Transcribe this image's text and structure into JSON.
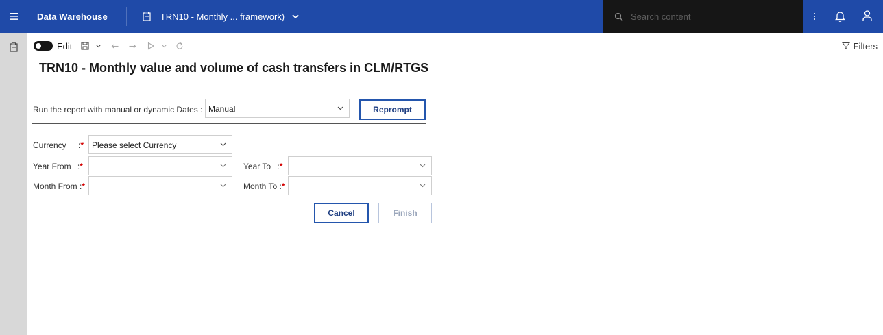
{
  "topbar": {
    "app_title": "Data Warehouse",
    "report_tab": "TRN10 - Monthly ... framework)",
    "search_placeholder": "Search content"
  },
  "toolbar": {
    "edit_label": "Edit",
    "filters_label": "Filters"
  },
  "page": {
    "title": "TRN10 - Monthly value and volume of cash transfers in CLM/RTGS"
  },
  "prompt": {
    "dates_label": "Run the report with manual or dynamic Dates :",
    "dates_value": "Manual",
    "reprompt_label": "Reprompt",
    "currency_label": "Currency",
    "currency_colon": ":",
    "currency_value": "Please select Currency",
    "year_from_label": "Year From",
    "year_from_colon": ":",
    "year_from_value": "",
    "year_to_label": "Year To",
    "year_to_colon": ":",
    "year_to_value": "",
    "month_from_label": "Month From :",
    "month_from_value": "",
    "month_to_label": "Month To :",
    "month_to_value": "",
    "required_marker": "*",
    "cancel_label": "Cancel",
    "finish_label": "Finish"
  },
  "colors": {
    "topbar": "#1f4aa8",
    "search_bg": "#161616",
    "left_rail": "#d8d8d8",
    "button_border": "#2456ad",
    "required": "#d40000"
  },
  "icons": [
    "menu-icon",
    "report-doc-icon",
    "chevron-down-icon",
    "search-icon",
    "overflow-menu-icon",
    "notification-bell-icon",
    "user-icon",
    "save-icon",
    "undo-icon",
    "redo-icon",
    "run-icon",
    "refresh-icon",
    "filter-icon"
  ]
}
